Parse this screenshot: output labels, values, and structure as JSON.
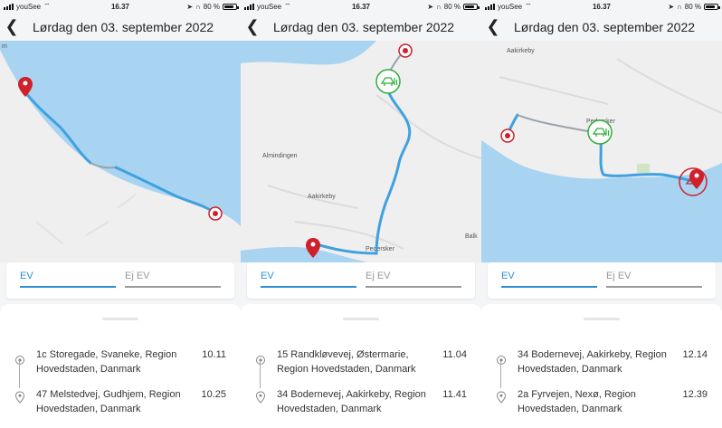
{
  "screens": [
    {
      "status": {
        "carrier": "youSee",
        "time": "16.37",
        "battery": "80 %"
      },
      "header": {
        "title": "Lørdag den 03. september 2022"
      },
      "tabs": {
        "ev": "EV",
        "non_ev": "Ej EV"
      },
      "map_labels": [
        "m"
      ],
      "stops": [
        {
          "address": "1c Storegade, Svaneke, Region Hovedstaden, Danmark",
          "time": "10.11"
        },
        {
          "address": "47 Melstedvej, Gudhjem, Region Hovedstaden, Danmark",
          "time": "10.25"
        }
      ]
    },
    {
      "status": {
        "carrier": "youSee",
        "time": "16.37",
        "battery": "80 %"
      },
      "header": {
        "title": "Lørdag den 03. september 2022"
      },
      "tabs": {
        "ev": "EV",
        "non_ev": "Ej EV"
      },
      "map_labels": [
        "Almindingen",
        "Aakirkeby",
        "Pedersker",
        "Balk"
      ],
      "stops": [
        {
          "address": "15 Randkløvevej, Østermarie, Region Hovedstaden, Danmark",
          "time": "11.04"
        },
        {
          "address": "34 Bodernevej, Aakirkeby, Region Hovedstaden, Danmark",
          "time": "11.41"
        }
      ]
    },
    {
      "status": {
        "carrier": "youSee",
        "time": "16.37",
        "battery": "80 %"
      },
      "header": {
        "title": "Lørdag den 03. september 2022"
      },
      "tabs": {
        "ev": "EV",
        "non_ev": "Ej EV"
      },
      "map_labels": [
        "Aakirkeby",
        "Pedersker"
      ],
      "stops": [
        {
          "address": "34 Bodernevej, Aakirkeby, Region Hovedstaden, Danmark",
          "time": "12.14"
        },
        {
          "address": "2a Fyrvejen, Nexø, Region Hovedstaden, Danmark",
          "time": "12.39"
        }
      ]
    }
  ],
  "colors": {
    "accent": "#2d8fd5",
    "route": "#3fa1e0",
    "pin": "#d0202a",
    "charger": "#2fae3c",
    "sea": "#a9d4f1",
    "land": "#efefef"
  }
}
